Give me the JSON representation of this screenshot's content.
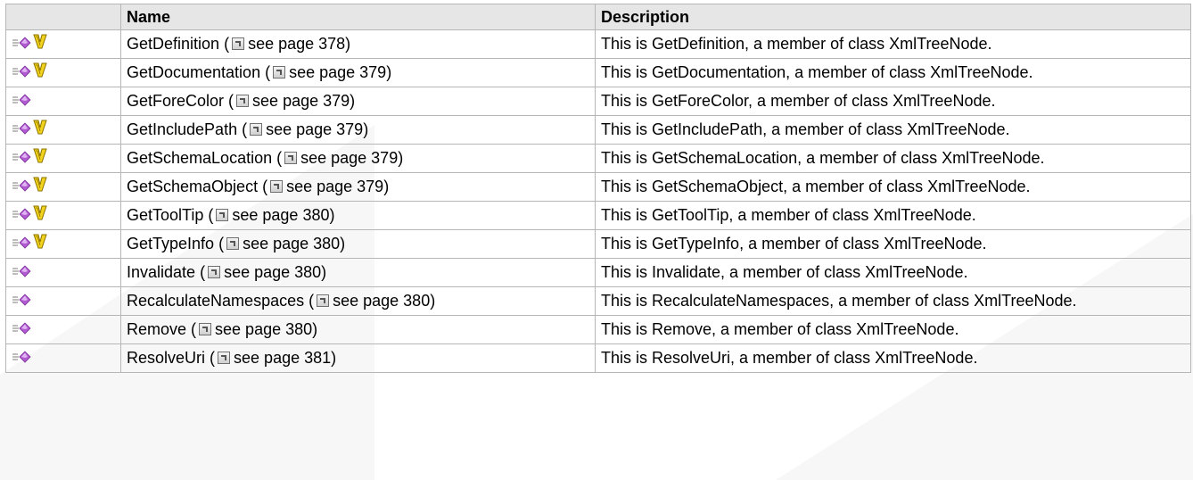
{
  "table": {
    "headers": {
      "icon": "",
      "name": "Name",
      "description": "Description"
    },
    "rows": [
      {
        "virtual": true,
        "name": "GetDefinition",
        "ref": "see page 378",
        "description": "This is GetDefinition, a member of class XmlTreeNode."
      },
      {
        "virtual": true,
        "name": "GetDocumentation",
        "ref": "see page 379",
        "description": "This is GetDocumentation, a member of class XmlTreeNode."
      },
      {
        "virtual": false,
        "name": "GetForeColor",
        "ref": "see page 379",
        "description": "This is GetForeColor, a member of class XmlTreeNode."
      },
      {
        "virtual": true,
        "name": "GetIncludePath",
        "ref": "see page 379",
        "description": "This is GetIncludePath, a member of class XmlTreeNode."
      },
      {
        "virtual": true,
        "name": "GetSchemaLocation",
        "ref": "see page 379",
        "description": "This is GetSchemaLocation, a member of class XmlTreeNode."
      },
      {
        "virtual": true,
        "name": "GetSchemaObject",
        "ref": "see page 379",
        "description": "This is GetSchemaObject, a member of class XmlTreeNode."
      },
      {
        "virtual": true,
        "name": "GetToolTip",
        "ref": "see page 380",
        "description": "This is GetToolTip, a member of class XmlTreeNode."
      },
      {
        "virtual": true,
        "name": "GetTypeInfo",
        "ref": "see page 380",
        "description": "This is GetTypeInfo, a member of class XmlTreeNode."
      },
      {
        "virtual": false,
        "name": "Invalidate",
        "ref": "see page 380",
        "description": "This is Invalidate, a member of class XmlTreeNode."
      },
      {
        "virtual": false,
        "name": "RecalculateNamespaces",
        "ref": "see page 380",
        "description": "This is RecalculateNamespaces, a member of class XmlTreeNode."
      },
      {
        "virtual": false,
        "name": "Remove",
        "ref": "see page 380",
        "description": "This is Remove, a member of class XmlTreeNode."
      },
      {
        "virtual": false,
        "name": "ResolveUri",
        "ref": "see page 381",
        "description": "This is ResolveUri, a member of class XmlTreeNode."
      }
    ]
  },
  "icons": {
    "method": "public-method-icon",
    "virtual": "virtual-method-icon",
    "reference": "page-reference-icon"
  },
  "colors": {
    "header_bg": "#e6e6e6",
    "border": "#b6b6b6",
    "method_icon": "#b05bd0",
    "virtual_icon": "#c9a800"
  }
}
